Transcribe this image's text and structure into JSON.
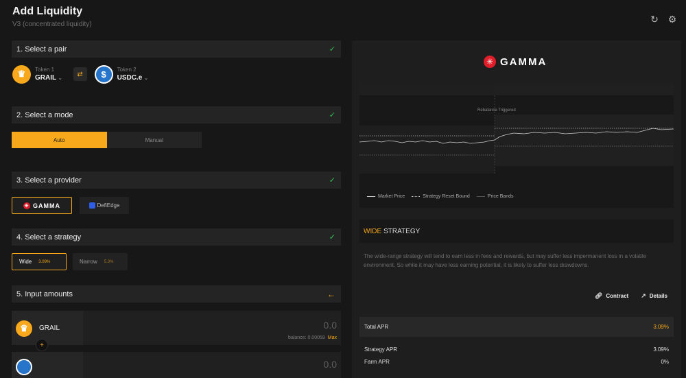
{
  "header": {
    "title": "Add Liquidity",
    "subtitle": "V3 (concentrated liquidity)",
    "refresh_icon": "refresh-icon",
    "settings_icon": "gear-icon"
  },
  "steps": {
    "pair": {
      "label": "1. Select a pair"
    },
    "mode": {
      "label": "2. Select a mode"
    },
    "provider": {
      "label": "3. Select a provider"
    },
    "strategy": {
      "label": "4. Select a strategy"
    },
    "amounts": {
      "label": "5. Input amounts"
    }
  },
  "pair": {
    "token1_label": "Token 1",
    "token1_symbol": "GRAIL",
    "token2_label": "Token 2",
    "token2_symbol": "USDC.e"
  },
  "modes": {
    "auto": "Auto",
    "manual": "Manual"
  },
  "providers": {
    "gamma": "GAMMA",
    "defiedge": "DefiEdge"
  },
  "strategies": {
    "wide_label": "Wide",
    "wide_pct": "3.09%",
    "narrow_label": "Narrow",
    "narrow_pct": "5.3%"
  },
  "amounts": {
    "token1_symbol": "GRAIL",
    "token1_value": "0.0",
    "token1_balance": "balance: 0.00059",
    "max_label": "Max",
    "token2_value": "0.0"
  },
  "panel": {
    "brand": "GAMMA",
    "chart_annotation": "Rebalance Triggered",
    "legend": {
      "market": "Market Price",
      "reset": "Strategy Reset Bound",
      "bands": "Price Bands"
    },
    "strategy_highlight": "WIDE",
    "strategy_title": "STRATEGY",
    "description": "The wide-range strategy will tend to earn less in fees and rewards, but may suffer less impermanent loss in a volatile environment. So while it may have less earning potential, it is likely to suffer less drawdowns.",
    "contract_label": "Contract",
    "details_label": "Details",
    "total_apr_label": "Total APR",
    "total_apr_value": "3.09%",
    "strategy_apr_label": "Strategy APR",
    "strategy_apr_value": "3.09%",
    "farm_apr_label": "Farm APR",
    "farm_apr_value": "0%"
  },
  "colors": {
    "accent": "#f7a81b",
    "success": "#34c759",
    "gamma_red": "#e11d2a",
    "usdc_blue": "#2775ca"
  }
}
